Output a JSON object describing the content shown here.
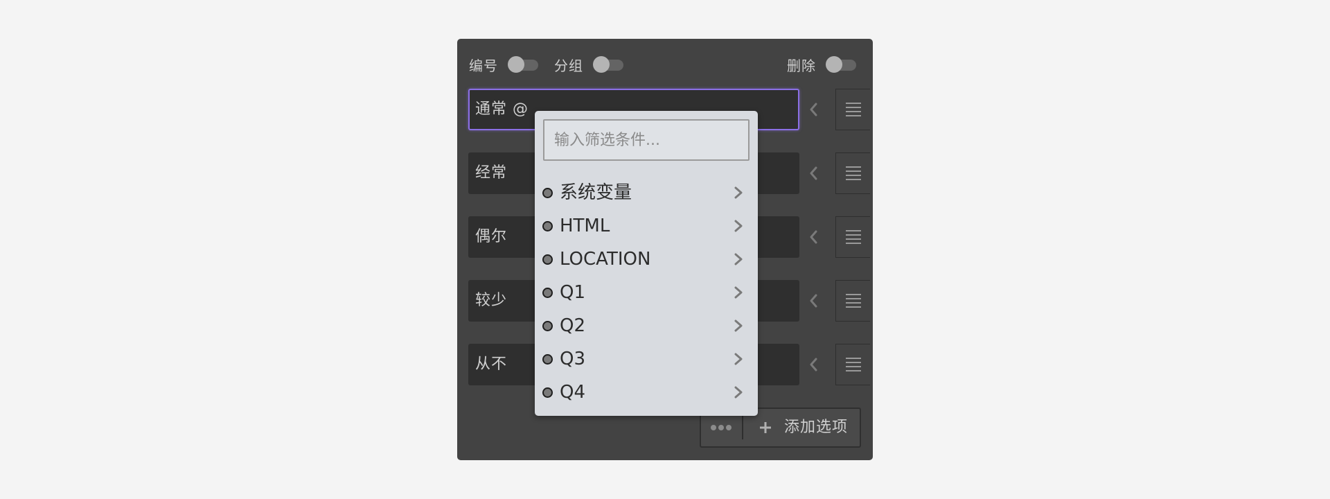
{
  "toggles": {
    "numbering_label": "编号",
    "grouping_label": "分组",
    "delete_label": "删除"
  },
  "options": [
    {
      "value": "通常 @"
    },
    {
      "value": "经常"
    },
    {
      "value": "偶尔"
    },
    {
      "value": "较少"
    },
    {
      "value": "从不"
    }
  ],
  "footer": {
    "add_label": "添加选项"
  },
  "dropdown": {
    "filter_placeholder": "输入筛选条件...",
    "items": [
      {
        "label": "系统变量"
      },
      {
        "label": "HTML"
      },
      {
        "label": "LOCATION"
      },
      {
        "label": "Q1"
      },
      {
        "label": "Q2"
      },
      {
        "label": "Q3"
      },
      {
        "label": "Q4"
      }
    ]
  },
  "colors": {
    "panel_bg": "#434343",
    "input_bg": "#2f2f2f",
    "focus_accent": "#8b6fe6",
    "dropdown_bg": "#d8dbe0"
  },
  "icons": {
    "collapse": "chevron-left-icon",
    "drag": "drag-lines-icon",
    "more": "more-dots-icon",
    "add": "plus-icon",
    "submenu": "chevron-right-icon",
    "bullet": "bullet-dot-icon"
  }
}
